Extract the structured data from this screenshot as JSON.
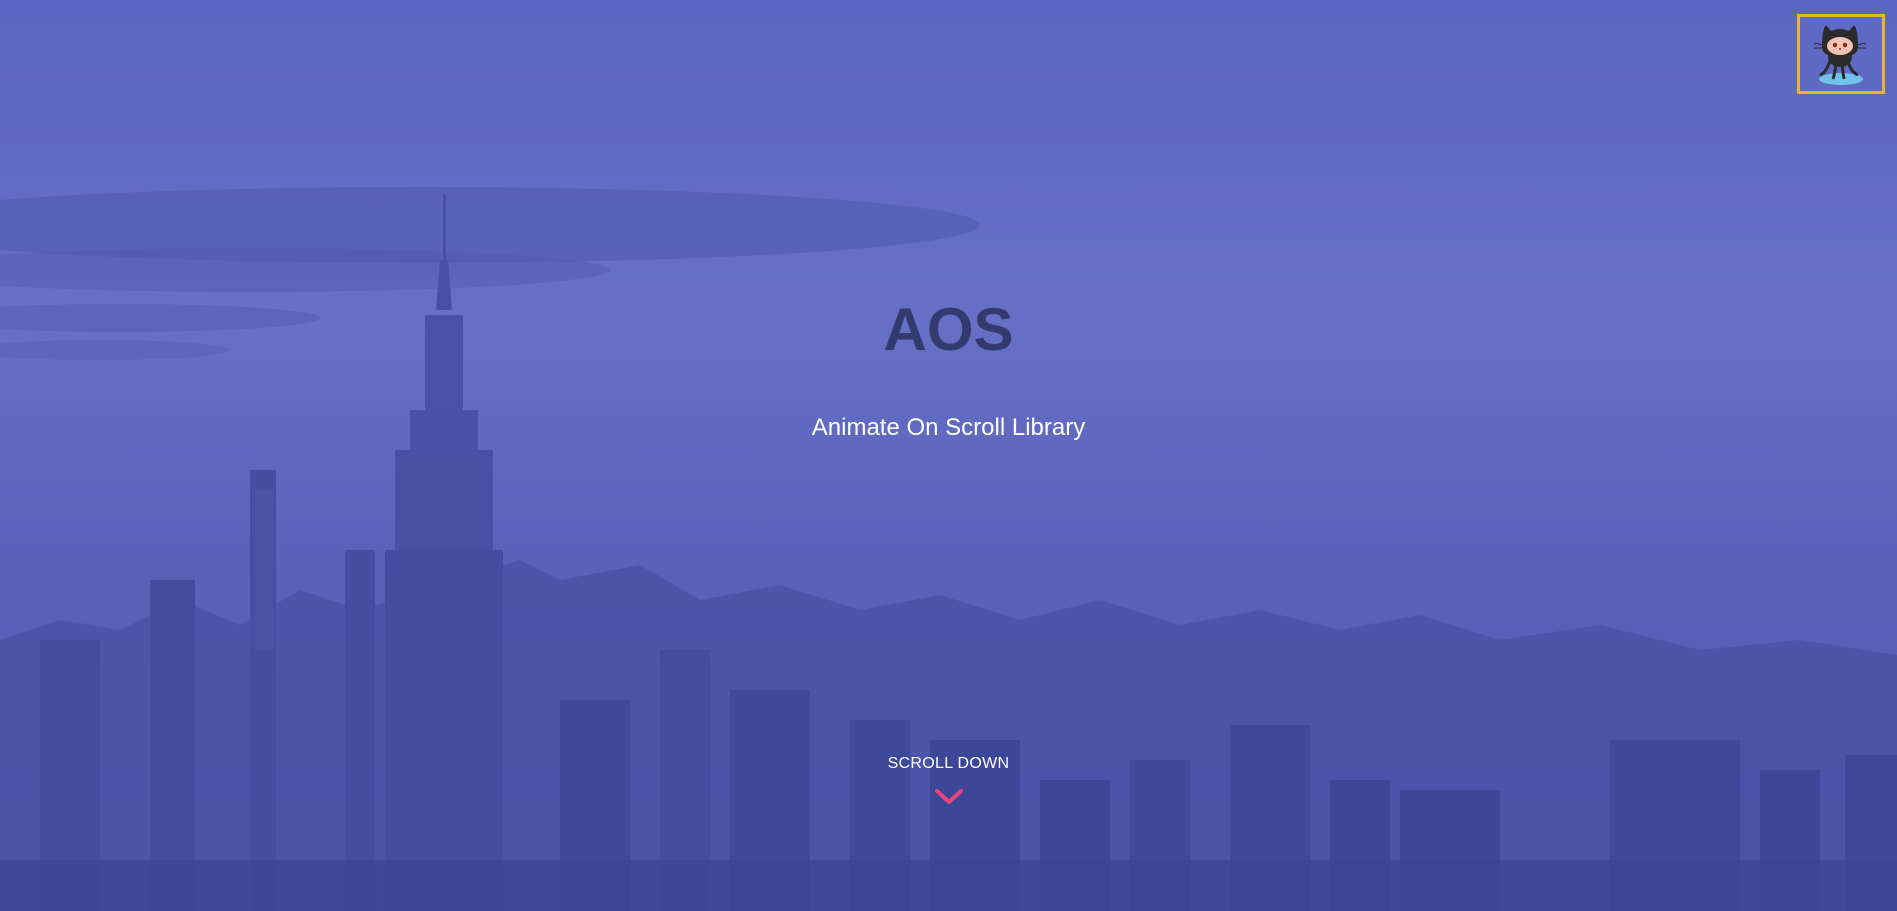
{
  "hero": {
    "title": "AOS",
    "subtitle": "Animate On Scroll Library",
    "scroll_label": "SCROLL DOWN"
  },
  "icons": {
    "github": "octocat-icon",
    "scroll": "chevron-down-icon"
  },
  "colors": {
    "overlay": "#5b66c2",
    "title": "#323a6e",
    "accent": "#e8457a",
    "github_border": "#e7b62a"
  }
}
